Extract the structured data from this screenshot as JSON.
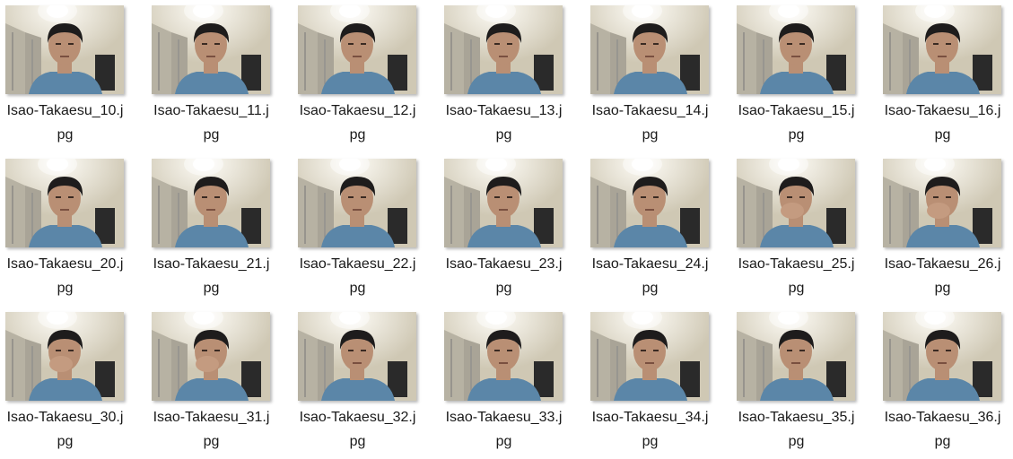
{
  "view": "file-explorer-large-icons",
  "files": [
    {
      "name": "Isao-Takaesu_10.jpg",
      "line1": "Isao-Takaesu_10.j",
      "line2": "pg",
      "pose": "neutral"
    },
    {
      "name": "Isao-Takaesu_11.jpg",
      "line1": "Isao-Takaesu_11.j",
      "line2": "pg",
      "pose": "neutral"
    },
    {
      "name": "Isao-Takaesu_12.jpg",
      "line1": "Isao-Takaesu_12.j",
      "line2": "pg",
      "pose": "neutral"
    },
    {
      "name": "Isao-Takaesu_13.jpg",
      "line1": "Isao-Takaesu_13.j",
      "line2": "pg",
      "pose": "neutral"
    },
    {
      "name": "Isao-Takaesu_14.jpg",
      "line1": "Isao-Takaesu_14.j",
      "line2": "pg",
      "pose": "neutral"
    },
    {
      "name": "Isao-Takaesu_15.jpg",
      "line1": "Isao-Takaesu_15.j",
      "line2": "pg",
      "pose": "neutral"
    },
    {
      "name": "Isao-Takaesu_16.jpg",
      "line1": "Isao-Takaesu_16.j",
      "line2": "pg",
      "pose": "neutral"
    },
    {
      "name": "Isao-Takaesu_20.jpg",
      "line1": "Isao-Takaesu_20.j",
      "line2": "pg",
      "pose": "neutral"
    },
    {
      "name": "Isao-Takaesu_21.jpg",
      "line1": "Isao-Takaesu_21.j",
      "line2": "pg",
      "pose": "neutral"
    },
    {
      "name": "Isao-Takaesu_22.jpg",
      "line1": "Isao-Takaesu_22.j",
      "line2": "pg",
      "pose": "neutral"
    },
    {
      "name": "Isao-Takaesu_23.jpg",
      "line1": "Isao-Takaesu_23.j",
      "line2": "pg",
      "pose": "neutral"
    },
    {
      "name": "Isao-Takaesu_24.jpg",
      "line1": "Isao-Takaesu_24.j",
      "line2": "pg",
      "pose": "neutral"
    },
    {
      "name": "Isao-Takaesu_25.jpg",
      "line1": "Isao-Takaesu_25.j",
      "line2": "pg",
      "pose": "hand-on-face"
    },
    {
      "name": "Isao-Takaesu_26.jpg",
      "line1": "Isao-Takaesu_26.j",
      "line2": "pg",
      "pose": "hand-on-face"
    },
    {
      "name": "Isao-Takaesu_30.jpg",
      "line1": "Isao-Takaesu_30.j",
      "line2": "pg",
      "pose": "hand-on-face"
    },
    {
      "name": "Isao-Takaesu_31.jpg",
      "line1": "Isao-Takaesu_31.j",
      "line2": "pg",
      "pose": "hand-on-face"
    },
    {
      "name": "Isao-Takaesu_32.jpg",
      "line1": "Isao-Takaesu_32.j",
      "line2": "pg",
      "pose": "neutral"
    },
    {
      "name": "Isao-Takaesu_33.jpg",
      "line1": "Isao-Takaesu_33.j",
      "line2": "pg",
      "pose": "neutral"
    },
    {
      "name": "Isao-Takaesu_34.jpg",
      "line1": "Isao-Takaesu_34.j",
      "line2": "pg",
      "pose": "neutral"
    },
    {
      "name": "Isao-Takaesu_35.jpg",
      "line1": "Isao-Takaesu_35.j",
      "line2": "pg",
      "pose": "neutral"
    },
    {
      "name": "Isao-Takaesu_36.jpg",
      "line1": "Isao-Takaesu_36.j",
      "line2": "pg",
      "pose": "neutral"
    }
  ],
  "colors": {
    "wall": "#cfc8b4",
    "shirt": "#5b86a8",
    "skin": "#b98f74",
    "hair": "#1e1c1c",
    "light": "#ffffff",
    "label": "#1a1a1a"
  }
}
